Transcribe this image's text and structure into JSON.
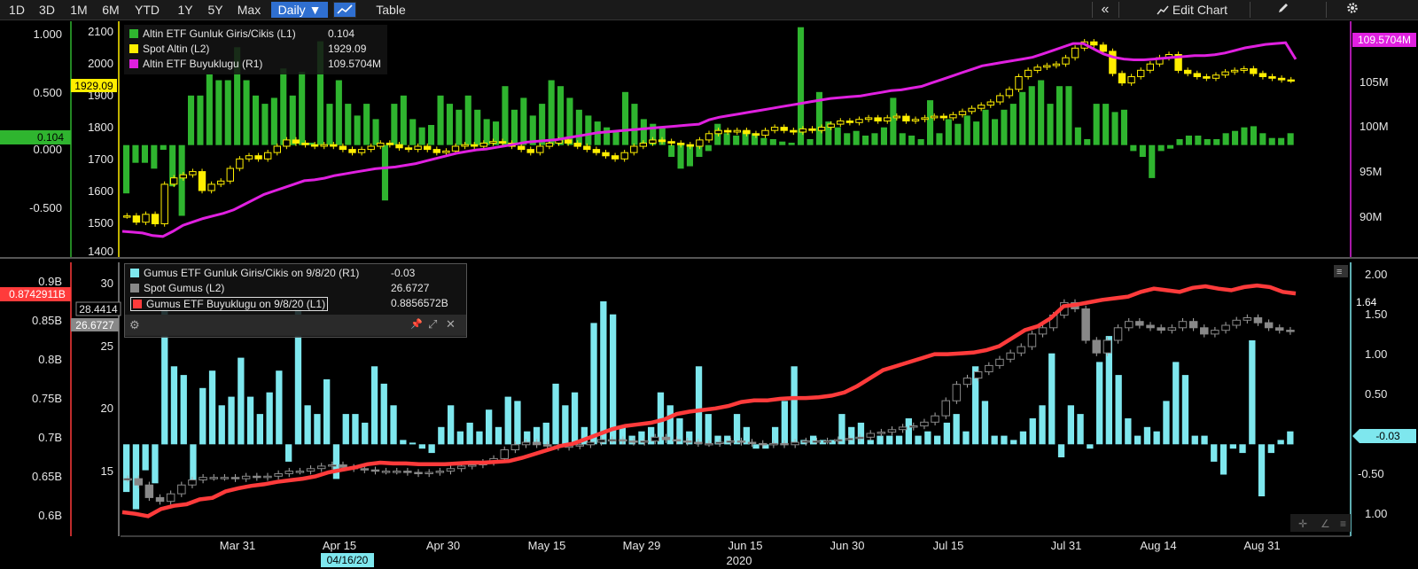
{
  "toolbar": {
    "ranges": [
      "1D",
      "3D",
      "1M",
      "6M",
      "YTD",
      "1Y",
      "5Y",
      "Max"
    ],
    "frequency": "Daily ▼",
    "table": "Table",
    "collapse": "«",
    "edit_chart": "Edit Chart",
    "pencil_icon": "pencil-icon",
    "gear_icon": "gear-icon",
    "chart_icon": "line-chart-icon"
  },
  "colors": {
    "green": "#2fb52f",
    "yellow": "#ffee00",
    "magenta": "#e020e0",
    "cyan": "#7ee7ee",
    "gray": "#888888",
    "red": "#ff3b3b"
  },
  "top_panel": {
    "legend": [
      {
        "name": "Altin ETF Gunluk Giris/Cikis (L1)",
        "value": "0.104",
        "color": "#2fb52f"
      },
      {
        "name": "Spot Altin (L2)",
        "value": "1929.09",
        "color": "#ffee00"
      },
      {
        "name": "Altin ETF Buyuklugu (R1)",
        "value": "109.5704M",
        "color": "#e020e0"
      }
    ],
    "left1_ticks": [
      "1.000",
      "0.500",
      "0.000",
      "-0.500"
    ],
    "left2_ticks": [
      "2100",
      "2000",
      "1900",
      "1800",
      "1700",
      "1600",
      "1500",
      "1400"
    ],
    "right_ticks": [
      "105M",
      "100M",
      "95M",
      "90M"
    ],
    "tag_spot": "1929.09",
    "tag_flow": "0.104",
    "tag_size": "109.5704M"
  },
  "bottom_panel": {
    "legend": [
      {
        "name": "Gumus ETF Gunluk Giris/Cikis on 9/8/20 (R1)",
        "value": "-0.03",
        "color": "#7ee7ee"
      },
      {
        "name": "Spot Gumus (L2)",
        "value": "26.6727",
        "color": "#888888"
      },
      {
        "name": "Gumus ETF Buyuklugu on 9/8/20 (L1)",
        "value": "0.8856572B",
        "color": "#ff3b3b"
      }
    ],
    "left1_ticks": [
      "0.9B",
      "0.85B",
      "0.8B",
      "0.75B",
      "0.7B",
      "0.65B",
      "0.6B"
    ],
    "left2_ticks": [
      "30",
      "25",
      "20",
      "15"
    ],
    "right_ticks": [
      "2.00",
      "1.50",
      "1.00",
      "0.50",
      "-0.50",
      "1.00"
    ],
    "tag_size": "0.8742911B",
    "tag_silver_a": "28.4414",
    "tag_silver_b": "26.6727",
    "tag_flow_r": "1.64",
    "tag_flow_cur": "-0.03"
  },
  "x_axis": {
    "labels": [
      "Mar 31",
      "Apr 15",
      "Apr 30",
      "May 15",
      "May 29",
      "Jun 15",
      "Jun 30",
      "Jul 15",
      "Jul 31",
      "Aug 14",
      "Aug 31"
    ],
    "year": "2020",
    "cursor_date": "04/16/20"
  },
  "chart_data": [
    {
      "type": "bar",
      "title": "",
      "series": [
        {
          "name": "Altin ETF Gunluk Giris/Cikis (L1)",
          "axis": "L1",
          "kind": "bar",
          "values": [
            -0.41,
            -0.15,
            -0.15,
            -0.2,
            -0.04,
            -0.35,
            -0.6,
            0.42,
            0.42,
            0.6,
            0.55,
            0.55,
            0.83,
            0.55,
            0.42,
            0.35,
            0.4,
            0.65,
            0.42,
            0.62,
            0.02,
            0.88,
            0.35,
            0.55,
            0.35,
            0.25,
            0.35,
            0.22,
            -0.47,
            0.35,
            0.42,
            0.22,
            0.15,
            0.17,
            0.42,
            0.35,
            0.3,
            0.42,
            0.3,
            0.22,
            0.2,
            0.5,
            0.3,
            0.4,
            0.25,
            0.35,
            0.55,
            0.5,
            0.4,
            0.3,
            0.25,
            0.2,
            0.15,
            0.12,
            0.45,
            0.35,
            0.22,
            0.18,
            0.15,
            -0.1,
            -0.2,
            -0.18,
            -0.1,
            -0.05,
            0.18,
            0.1,
            0.08,
            0.12,
            0.1,
            0.06,
            0.05,
            0.03,
            0.02,
            1.0,
            0.05,
            0.45,
            0.2,
            0.15,
            0.1,
            0.12,
            0.08,
            0.1,
            0.15,
            0.4,
            0.1,
            0.08,
            0.05,
            0.38,
            0.1,
            0.22,
            0.18,
            0.25,
            0.2,
            0.3,
            0.22,
            0.3,
            0.35,
            0.45,
            0.5,
            0.55,
            0.35,
            0.5,
            0.5,
            0.15,
            0.05,
            0.35,
            0.35,
            0.28,
            0.3,
            -0.05,
            -0.1,
            -0.28,
            -0.05,
            -0.03,
            0.05,
            0.08,
            0.08,
            0.05,
            0.05,
            0.1,
            0.12,
            0.15,
            0.16,
            0.1,
            0.06,
            0.06,
            0.1
          ]
        },
        {
          "name": "Spot Altin (L2)",
          "axis": "L2",
          "kind": "candlestick",
          "values": [
            1500,
            1480,
            1505,
            1475,
            1600,
            1620,
            1630,
            1640,
            1580,
            1600,
            1610,
            1650,
            1680,
            1690,
            1680,
            1700,
            1720,
            1740,
            1730,
            1725,
            1720,
            1725,
            1720,
            1710,
            1700,
            1710,
            1720,
            1730,
            1725,
            1715,
            1710,
            1720,
            1710,
            1700,
            1705,
            1720,
            1725,
            1720,
            1730,
            1735,
            1730,
            1720,
            1710,
            1700,
            1720,
            1730,
            1740,
            1730,
            1720,
            1710,
            1700,
            1690,
            1680,
            1700,
            1720,
            1730,
            1740,
            1735,
            1730,
            1725,
            1720,
            1740,
            1760,
            1770,
            1765,
            1770,
            1760,
            1755,
            1770,
            1780,
            1770,
            1765,
            1775,
            1770,
            1780,
            1790,
            1800,
            1795,
            1805,
            1810,
            1800,
            1810,
            1815,
            1800,
            1805,
            1810,
            1815,
            1810,
            1820,
            1830,
            1840,
            1850,
            1860,
            1880,
            1900,
            1940,
            1960,
            1970,
            1975,
            1980,
            2000,
            2030,
            2050,
            2040,
            2020,
            1950,
            1920,
            1940,
            1960,
            1980,
            2000,
            2010,
            1960,
            1950,
            1940,
            1935,
            1945,
            1955,
            1960,
            1965,
            1950,
            1940,
            1935,
            1930,
            1929
          ]
        },
        {
          "name": "Altin ETF Buyuklugu (R1)",
          "axis": "R1",
          "kind": "line",
          "values": [
            89.5,
            89.4,
            89.3,
            89.0,
            88.9,
            89.5,
            90.2,
            90.6,
            91.0,
            91.3,
            91.6,
            92.0,
            92.6,
            93.2,
            93.8,
            94.2,
            94.6,
            95.0,
            95.4,
            95.5,
            95.7,
            96.0,
            96.2,
            96.4,
            96.6,
            96.8,
            96.9,
            97.0,
            97.2,
            97.4,
            97.7,
            98.0,
            98.3,
            98.6,
            98.8,
            99.0,
            99.1,
            99.3,
            99.5,
            99.7,
            99.9,
            100.0,
            100.1,
            100.2,
            100.4,
            100.6,
            100.8,
            101.0,
            101.1,
            101.2,
            101.3,
            101.4,
            101.5,
            101.6,
            101.7,
            101.8,
            101.9,
            102.0,
            102.5,
            102.8,
            103.0,
            103.2,
            103.4,
            103.6,
            103.8,
            104.0,
            104.2,
            104.4,
            104.6,
            104.8,
            105.0,
            105.1,
            105.2,
            105.3,
            105.5,
            105.7,
            105.9,
            106.0,
            106.2,
            106.4,
            106.8,
            107.2,
            107.6,
            108.0,
            108.4,
            108.8,
            109.0,
            109.2,
            109.4,
            109.6,
            109.8,
            110.2,
            110.6,
            111.0,
            111.4,
            111.4,
            110.8,
            110.2,
            109.8,
            109.6,
            109.5,
            109.5,
            109.6,
            109.7,
            109.8,
            109.9,
            110.0,
            110.0,
            110.1,
            110.3,
            110.6,
            110.9,
            111.1,
            111.3,
            111.4,
            111.5,
            109.57
          ]
        }
      ],
      "axes": {
        "L1": [
          -0.95,
          1.05
        ],
        "L2": [
          1370,
          2115
        ],
        "R1": [
          86.5,
          114
        ]
      }
    },
    {
      "type": "bar",
      "title": "",
      "series": [
        {
          "name": "Gumus ETF Gunluk Giris/Cikis on 9/8/20 (R1)",
          "axis": "R1",
          "kind": "bar",
          "values": [
            -0.55,
            -0.75,
            -0.3,
            -0.45,
            1.55,
            0.9,
            0.8,
            -0.45,
            0.65,
            0.85,
            0.45,
            0.55,
            1.0,
            0.55,
            0.35,
            0.6,
            0.85,
            -0.2,
            1.55,
            0.45,
            0.35,
            0.75,
            -0.4,
            0.35,
            0.35,
            0.25,
            0.9,
            0.7,
            0.45,
            0.05,
            0.02,
            -0.05,
            -0.1,
            0.2,
            0.45,
            0.15,
            0.25,
            0.15,
            0.4,
            0.2,
            0.55,
            0.5,
            0.15,
            0.2,
            0.25,
            0.7,
            0.45,
            0.6,
            0.2,
            1.4,
            1.65,
            1.5,
            0.2,
            0.1,
            0.15,
            0.2,
            0.6,
            0.45,
            0.3,
            0.15,
            0.9,
            0.35,
            0.1,
            0.1,
            0.35,
            0.2,
            -0.05,
            -0.05,
            0.2,
            0.5,
            0.9,
            0.05,
            0.1,
            0.05,
            0.05,
            0.35,
            0.2,
            0.25,
            0.05,
            0.1,
            0.1,
            0.1,
            0.3,
            0.1,
            0.15,
            0.1,
            0.25,
            0.35,
            0.15,
            0.9,
            0.5,
            0.1,
            0.1,
            0.05,
            0.15,
            0.3,
            0.45,
            1.05,
            -0.15,
            0.45,
            0.35,
            -0.05,
            0.95,
            1.25,
            0.8,
            0.3,
            0.1,
            0.2,
            0.15,
            0.5,
            0.95,
            0.8,
            0.1,
            0.1,
            -0.2,
            -0.35,
            -0.05,
            -0.1,
            1.2,
            -0.6,
            -0.1,
            0.05,
            0.15
          ]
        },
        {
          "name": "Spot Gumus (L2)",
          "axis": "L2",
          "kind": "candlestick",
          "values": [
            15.0,
            14.5,
            13.5,
            13.2,
            13.8,
            14.5,
            14.9,
            15.1,
            15.1,
            15.1,
            15.0,
            15.2,
            15.1,
            15.2,
            15.4,
            15.6,
            15.6,
            15.8,
            16.0,
            16.1,
            15.9,
            15.8,
            15.7,
            15.6,
            15.6,
            15.6,
            15.5,
            15.4,
            15.5,
            15.6,
            15.8,
            16.0,
            16.1,
            16.3,
            16.6,
            17.3,
            17.7,
            17.9,
            17.7,
            17.6,
            17.5,
            17.6,
            17.7,
            17.9,
            18.1,
            18.1,
            18.0,
            17.9,
            18.0,
            18.3,
            18.1,
            18.0,
            17.9,
            17.8,
            17.8,
            17.9,
            18.0,
            17.9,
            17.8,
            17.7,
            17.8,
            17.7,
            17.9,
            18.0,
            18.0,
            18.0,
            18.1,
            18.2,
            18.3,
            18.6,
            18.7,
            18.9,
            19.1,
            19.2,
            19.5,
            20.0,
            21.2,
            22.5,
            23.0,
            23.5,
            24.0,
            24.5,
            25.0,
            25.5,
            26.5,
            27.0,
            28.0,
            29.0,
            28.5,
            26.0,
            25.0,
            26.0,
            27.0,
            27.5,
            27.2,
            27.0,
            26.8,
            27.0,
            27.5,
            27.0,
            26.5,
            26.8,
            27.2,
            27.6,
            27.8,
            27.4,
            27.0,
            26.8,
            26.7
          ]
        },
        {
          "name": "Gumus ETF Buyuklugu on 9/8/20 (L1)",
          "axis": "L1",
          "kind": "line",
          "values": [
            0.612,
            0.61,
            0.607,
            0.616,
            0.62,
            0.622,
            0.628,
            0.63,
            0.638,
            0.642,
            0.645,
            0.647,
            0.65,
            0.652,
            0.654,
            0.657,
            0.662,
            0.665,
            0.668,
            0.672,
            0.674,
            0.673,
            0.673,
            0.672,
            0.672,
            0.672,
            0.673,
            0.674,
            0.674,
            0.675,
            0.676,
            0.68,
            0.685,
            0.69,
            0.695,
            0.698,
            0.704,
            0.71,
            0.716,
            0.72,
            0.722,
            0.724,
            0.728,
            0.735,
            0.738,
            0.74,
            0.742,
            0.745,
            0.75,
            0.752,
            0.752,
            0.754,
            0.755,
            0.755,
            0.756,
            0.758,
            0.762,
            0.77,
            0.78,
            0.79,
            0.795,
            0.8,
            0.805,
            0.81,
            0.81,
            0.811,
            0.812,
            0.815,
            0.82,
            0.83,
            0.84,
            0.845,
            0.855,
            0.87,
            0.872,
            0.875,
            0.878,
            0.88,
            0.882,
            0.888,
            0.892,
            0.89,
            0.888,
            0.893,
            0.895,
            0.892,
            0.89,
            0.894,
            0.896,
            0.894,
            0.888,
            0.886
          ]
        }
      ],
      "axes": {
        "L1": [
          0.583,
          0.925
        ],
        "L2": [
          10.5,
          32.2
        ],
        "R1": [
          -1.05,
          2.1
        ]
      }
    }
  ]
}
